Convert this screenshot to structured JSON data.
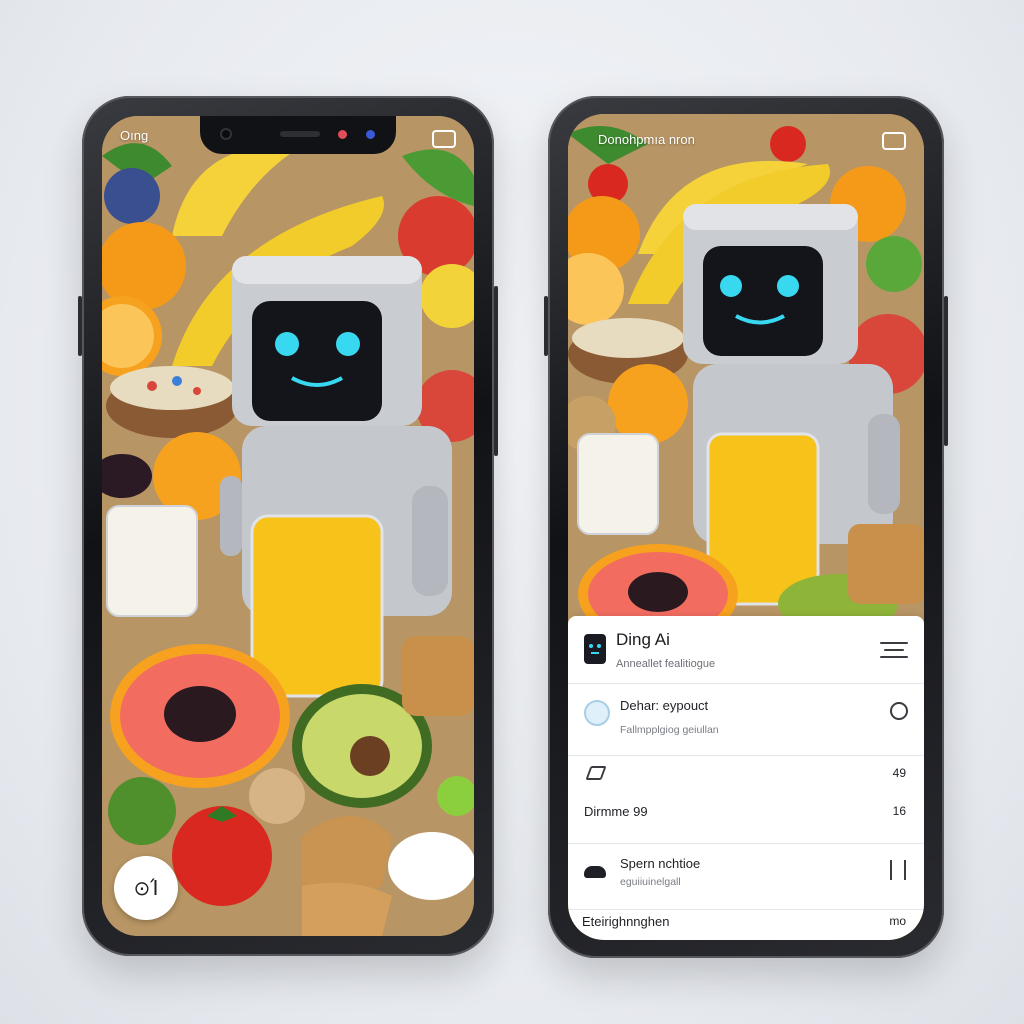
{
  "left_phone": {
    "status_text": "Oıng",
    "home_button_label": "⊙Ί"
  },
  "right_phone": {
    "status_text": "Donohpmıa nron",
    "app": {
      "title": "Ding Ai",
      "subtitle": "Anneallet fealitiogue",
      "icon": "robot-face-icon"
    },
    "rows": [
      {
        "title": "Dehar: eypouct",
        "subtitle": "Fallmpplgiog geiullan",
        "icon": "droplet-icon",
        "action_icon": "timer-icon"
      },
      {
        "title": "",
        "subtitle": "",
        "icon": "pencil-icon",
        "value": "49"
      },
      {
        "title": "Dirmme 99",
        "value": "16"
      },
      {
        "title": "Spern nchtioe",
        "subtitle": "eguiiuinelgall",
        "icon": "cloud-icon",
        "action_icon": "sliders-icon"
      },
      {
        "title": "Eteirighnnghen",
        "value": "mo"
      }
    ]
  },
  "colors": {
    "frame": "#16171b",
    "card": "#ffffff",
    "robot_eye": "#38d9f0",
    "juice": "#f7c21a"
  }
}
